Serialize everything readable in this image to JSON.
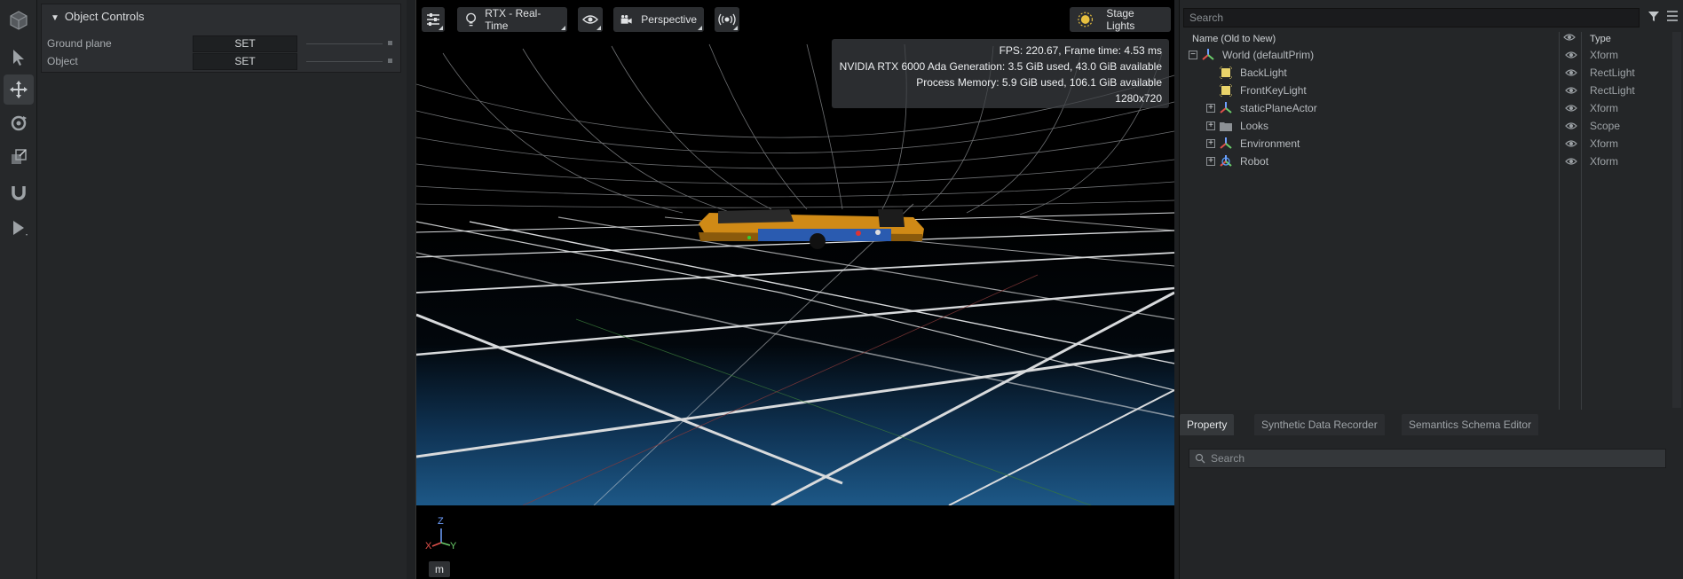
{
  "toolbar": {
    "tools": [
      {
        "name": "cube-stage-icon"
      },
      {
        "name": "select-arrow-icon"
      },
      {
        "name": "move-icon",
        "active": true
      },
      {
        "name": "rotate-icon"
      },
      {
        "name": "scale-icon"
      },
      {
        "name": "snap-magnet-icon"
      },
      {
        "name": "play-icon"
      }
    ]
  },
  "object_controls": {
    "title": "Object Controls",
    "rows": [
      {
        "label": "Ground plane",
        "button": "SET"
      },
      {
        "label": "Object",
        "button": "SET"
      }
    ]
  },
  "viewport": {
    "settings_icon": "sliders-icon",
    "renderer_label": "RTX - Real-Time",
    "camera_label": "Perspective",
    "lights_label": "Stage Lights",
    "stats": {
      "line1": "FPS: 220.67, Frame time: 4.53 ms",
      "line2": "NVIDIA RTX 6000 Ada Generation: 3.5 GiB used, 43.0 GiB available",
      "line3": "Process Memory: 5.9 GiB used, 106.1 GiB available",
      "line4": "1280x720"
    },
    "axes": {
      "z": "Z",
      "x": "X",
      "y": "Y"
    },
    "unit": "m"
  },
  "stage": {
    "search_placeholder": "Search",
    "header_name": "Name (Old to New)",
    "header_type": "Type",
    "items": [
      {
        "name": "World (defaultPrim)",
        "type": "Xform",
        "icon": "xform-icon",
        "expander": "−",
        "indent": 0
      },
      {
        "name": "BackLight",
        "type": "RectLight",
        "icon": "rect-light-icon",
        "expander": "",
        "indent": 1
      },
      {
        "name": "FrontKeyLight",
        "type": "RectLight",
        "icon": "rect-light-icon",
        "expander": "",
        "indent": 1
      },
      {
        "name": "staticPlaneActor",
        "type": "Xform",
        "icon": "xform-icon",
        "expander": "+",
        "indent": 1
      },
      {
        "name": "Looks",
        "type": "Scope",
        "icon": "folder-icon",
        "expander": "+",
        "indent": 1
      },
      {
        "name": "Environment",
        "type": "Xform",
        "icon": "xform-icon",
        "expander": "+",
        "indent": 1
      },
      {
        "name": "Robot",
        "type": "Xform",
        "icon": "robot-xform-icon",
        "expander": "+",
        "indent": 1
      }
    ]
  },
  "property": {
    "tabs": [
      "Property",
      "Synthetic Data Recorder",
      "Semantics Schema Editor"
    ],
    "active_tab": "Property",
    "search_placeholder": "Search"
  },
  "colors": {
    "accent": "#76b900",
    "floor_blue": "#1b4e78",
    "robot_orange": "#e59a1c"
  }
}
